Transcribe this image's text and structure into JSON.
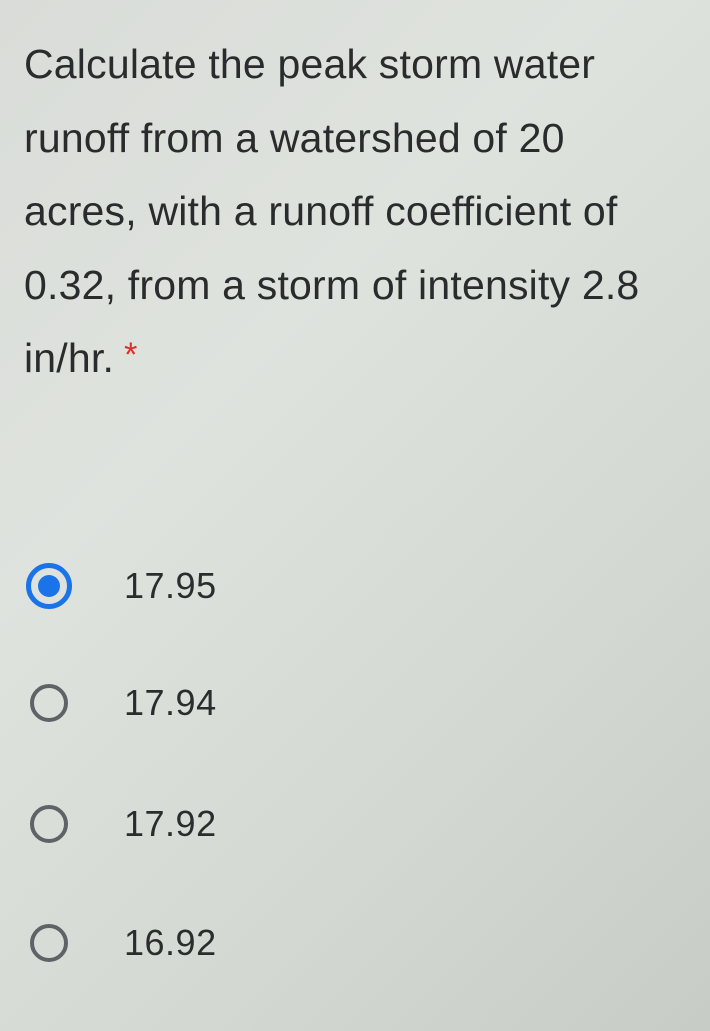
{
  "question": {
    "text": "Calculate the peak storm water runoff from a watershed of 20 acres, with a runoff coefficient of 0.32, from a storm of intensity 2.8 in/hr.",
    "required_marker": "*"
  },
  "options": [
    {
      "label": "17.95",
      "selected": true
    },
    {
      "label": "17.94",
      "selected": false
    },
    {
      "label": "17.92",
      "selected": false
    },
    {
      "label": "16.92",
      "selected": false
    }
  ],
  "colors": {
    "accent": "#1a73e8",
    "required": "#d93025",
    "radio_border": "#5f6368"
  }
}
